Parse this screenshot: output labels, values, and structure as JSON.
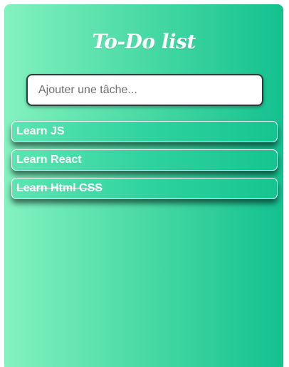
{
  "app": {
    "title": "To-Do list"
  },
  "input": {
    "placeholder": "Ajouter une tâche...",
    "value": ""
  },
  "tasks": [
    {
      "label": "Learn JS",
      "done": false
    },
    {
      "label": "Learn React",
      "done": false
    },
    {
      "label": "Learn Html CSS",
      "done": true
    }
  ],
  "colors": {
    "gradient_start": "#83f2bf",
    "gradient_end": "#13c18e",
    "text": "#ffffff",
    "input_border": "#2b3d3b"
  }
}
